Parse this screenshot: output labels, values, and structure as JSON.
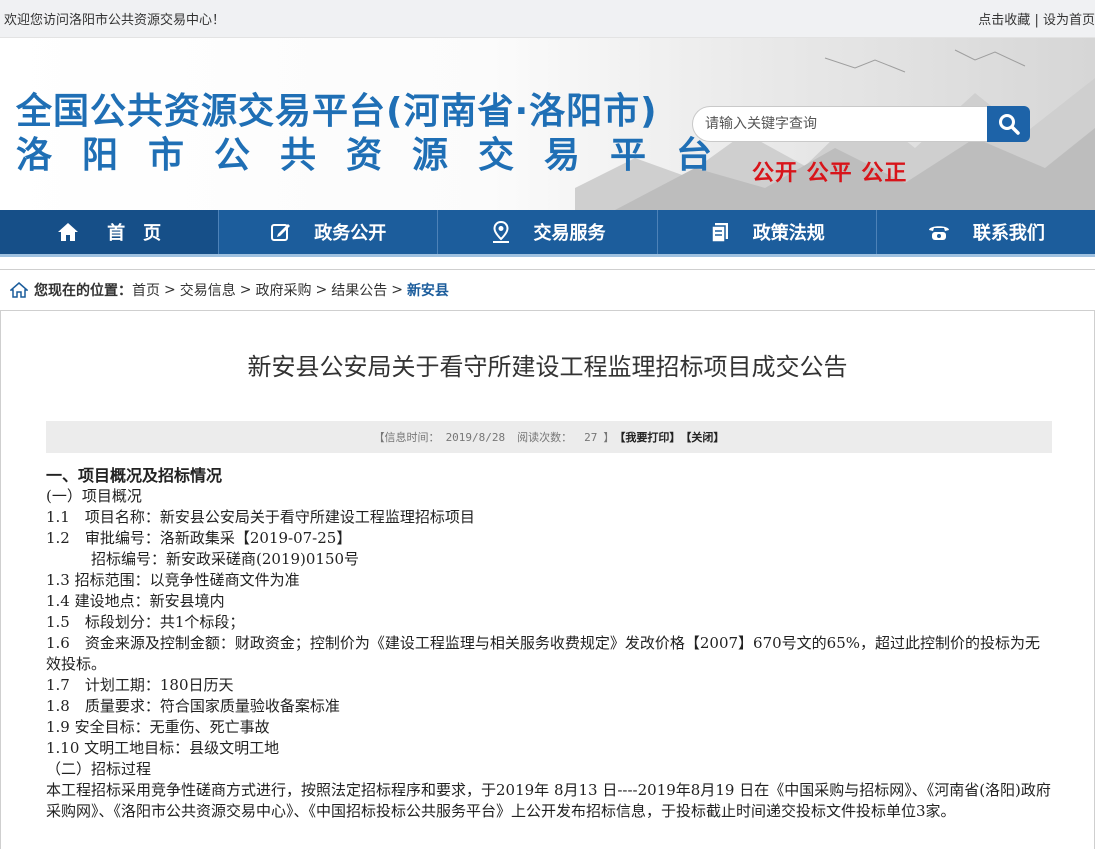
{
  "topbar": {
    "welcome": "欢迎您访问洛阳市公共资源交易中心！",
    "bookmark": "点击收藏",
    "divider": "|",
    "set_home": "设为首页"
  },
  "header": {
    "title_line1": "全国公共资源交易平台(河南省·洛阳市)",
    "title_line2": "洛阳市公共资源交易平台",
    "search_placeholder": "请输入关键字查询",
    "slogan": "公开 公平 公正"
  },
  "nav": {
    "items": [
      {
        "label": "首　页",
        "icon": "home-icon"
      },
      {
        "label": "政务公开",
        "icon": "edit-icon"
      },
      {
        "label": "交易服务",
        "icon": "map-pin-icon"
      },
      {
        "label": "政策法规",
        "icon": "documents-icon"
      },
      {
        "label": "联系我们",
        "icon": "phone-icon"
      }
    ]
  },
  "breadcrumb": {
    "label": "您现在的位置：",
    "items": [
      "首页",
      "交易信息",
      "政府采购",
      "结果公告"
    ],
    "current": "新安县",
    "separator": ">"
  },
  "article": {
    "title": "新安县公安局关于看守所建设工程监理招标项目成交公告",
    "info": {
      "time_label": "【信息时间：",
      "time_value": "2019/8/28",
      "reads_label": "阅读次数：",
      "reads_value": "27",
      "close_bracket": "】",
      "print": "【我要打印】",
      "close": "【关闭】"
    },
    "lines": [
      "一、项目概况及招标情况",
      "(一）项目概况",
      "1.1　项目名称：新安县公安局关于看守所建设工程监理招标项目",
      "1.2　审批编号：洛新政集采【2019-07-25】",
      "　　　招标编号：新安政采磋商(2019)0150号",
      "1.3 招标范围：以竞争性磋商文件为准",
      "1.4 建设地点：新安县境内",
      "1.5　标段划分：共1个标段；",
      "1.6　资金来源及控制金额：财政资金；控制价为《建设工程监理与相关服务收费规定》发改价格【2007】670号文的65%，超过此控制价的投标为无效投标。",
      "1.7　计划工期：180日历天",
      "1.8　质量要求：符合国家质量验收备案标准",
      "1.9 安全目标：无重伤、死亡事故",
      "1.10 文明工地目标：县级文明工地",
      "（二）招标过程",
      "本工程招标采用竞争性磋商方式进行，按照法定招标程序和要求，于2019年 8月13 日----2019年8月19 日在《中国采购与招标网》、《河南省(洛阳)政府采购网》、《洛阳市公共资源交易中心》、《中国招标投标公共服务平台》上公开发布招标信息，于投标截止时间递交投标文件投标单位3家。"
    ]
  },
  "colors": {
    "brand_blue": "#1c5d9c",
    "title_blue": "#1f6fb5",
    "slogan_red": "#d8141a"
  }
}
